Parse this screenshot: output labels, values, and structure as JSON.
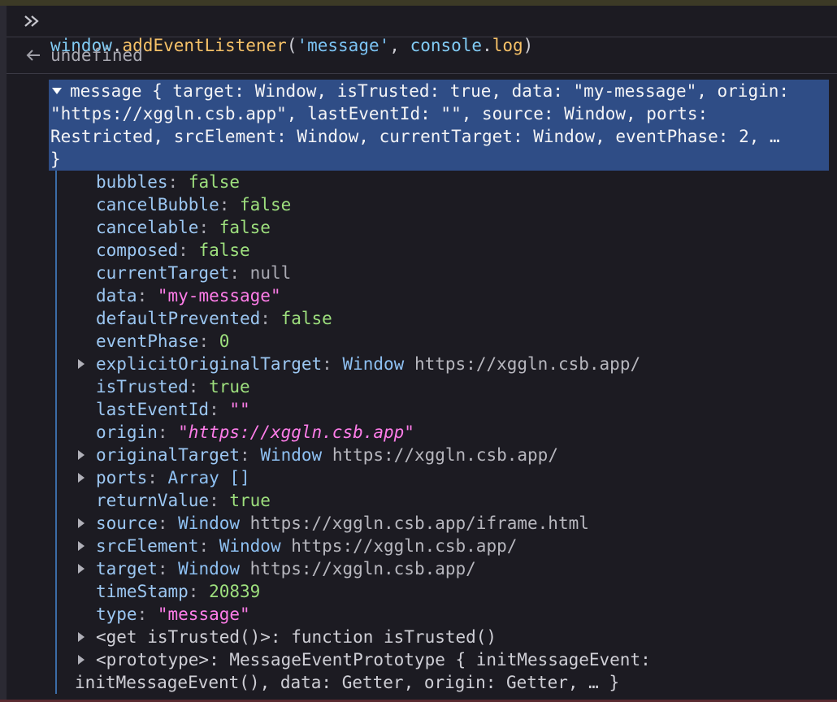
{
  "command": {
    "object": "window",
    "dot": ".",
    "method": "addEventListener",
    "open": "(",
    "arg_string": "'message'",
    "comma": ", ",
    "arg_object": "console",
    "dot2": ".",
    "arg_method": "log",
    "close": ")"
  },
  "result": {
    "value": "undefined"
  },
  "summary": {
    "line1": "message { target: Window, isTrusted: true, data: \"my-message\", origin:",
    "line2": "\"https://xggln.csb.app\", lastEventId: \"\", source: Window, ports:",
    "line3": "Restricted, srcElement: Window, currentTarget: Window, eventPhase: 2, …",
    "line4": "}"
  },
  "properties": [
    {
      "key": "bubbles",
      "value": "false",
      "type": "bool"
    },
    {
      "key": "cancelBubble",
      "value": "false",
      "type": "bool"
    },
    {
      "key": "cancelable",
      "value": "false",
      "type": "bool"
    },
    {
      "key": "composed",
      "value": "false",
      "type": "bool"
    },
    {
      "key": "currentTarget",
      "value": "null",
      "type": "null"
    },
    {
      "key": "data",
      "value": "\"my-message\"",
      "type": "string"
    },
    {
      "key": "defaultPrevented",
      "value": "false",
      "type": "bool"
    },
    {
      "key": "eventPhase",
      "value": "0",
      "type": "number"
    },
    {
      "key": "explicitOriginalTarget",
      "value": "Window",
      "url": "https://xggln.csb.app/",
      "type": "object"
    },
    {
      "key": "isTrusted",
      "value": "true",
      "type": "bool"
    },
    {
      "key": "lastEventId",
      "value": "\"\"",
      "type": "string"
    },
    {
      "key": "origin",
      "value": "\"https://xggln.csb.app\"",
      "type": "string-italic"
    },
    {
      "key": "originalTarget",
      "value": "Window",
      "url": "https://xggln.csb.app/",
      "type": "object"
    },
    {
      "key": "ports",
      "value": "Array []",
      "type": "object"
    },
    {
      "key": "returnValue",
      "value": "true",
      "type": "bool"
    },
    {
      "key": "source",
      "value": "Window",
      "url": "https://xggln.csb.app/iframe.html",
      "type": "object"
    },
    {
      "key": "srcElement",
      "value": "Window",
      "url": "https://xggln.csb.app/",
      "type": "object"
    },
    {
      "key": "target",
      "value": "Window",
      "url": "https://xggln.csb.app/",
      "type": "object"
    },
    {
      "key": "timeStamp",
      "value": "20839",
      "type": "number"
    },
    {
      "key": "type",
      "value": "\"message\"",
      "type": "string"
    }
  ],
  "getter": {
    "text": "<get isTrusted()>: function isTrusted()"
  },
  "prototype": {
    "line1": "<prototype>: MessageEventPrototype { initMessageEvent:",
    "line2": "initMessageEvent(), data: Getter, origin: Getter, … }"
  },
  "colors": {
    "background": "#1c1b22",
    "selection": "#2f4d86",
    "bool": "#9ee07e",
    "string": "#ff7de9",
    "key": "#9cc7f2"
  }
}
